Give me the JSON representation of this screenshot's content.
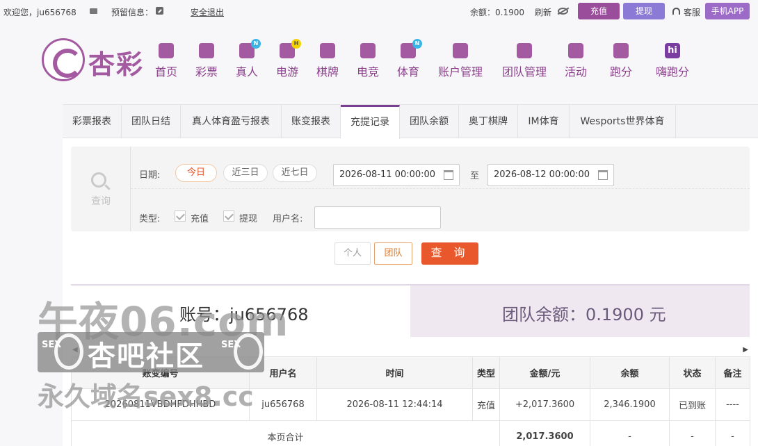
{
  "topbar": {
    "welcome": "欢迎您，ju656768",
    "preset_info": "预留信息：",
    "logout": "安全退出",
    "balance_label": "余额：0.1900",
    "refresh": "刷新",
    "recharge": "充值",
    "withdraw": "提现",
    "service": "客服",
    "app": "手机APP"
  },
  "brand": {
    "name": "杏彩"
  },
  "nav": [
    {
      "label": "首页",
      "icon": "home-icon"
    },
    {
      "label": "彩票",
      "icon": "lottery-icon"
    },
    {
      "label": "真人",
      "icon": "live-dealer-icon",
      "badge": "N"
    },
    {
      "label": "电游",
      "icon": "gamepad-icon",
      "badge": "H"
    },
    {
      "label": "棋牌",
      "icon": "cards-icon"
    },
    {
      "label": "电竞",
      "icon": "esports-icon"
    },
    {
      "label": "体育",
      "icon": "trophy-icon",
      "badge": "N"
    },
    {
      "label": "账户管理",
      "icon": "account-icon"
    },
    {
      "label": "团队管理",
      "icon": "team-icon"
    },
    {
      "label": "活动",
      "icon": "gift-icon"
    },
    {
      "label": "跑分",
      "icon": "car-icon"
    },
    {
      "label": "嗨跑分",
      "icon": "hi-icon",
      "icon_text": "hi"
    }
  ],
  "tabs": [
    "彩票报表",
    "团队日结",
    "真人体育盈亏报表",
    "账变报表",
    "充提记录",
    "团队余额",
    "奥丁棋牌",
    "IM体育",
    "Wesports世界体育"
  ],
  "search": {
    "side_label": "查询",
    "date_label": "日期:",
    "ranges": [
      "今日",
      "近三日",
      "近七日"
    ],
    "start_date": "2026-08-11 00:00:00",
    "to": "至",
    "end_date": "2026-08-12 00:00:00",
    "type_label": "类型:",
    "type_recharge": "充值",
    "type_withdraw": "提现",
    "username_label": "用户名:",
    "username_value": ""
  },
  "buttons": {
    "personal": "个人",
    "team": "团队",
    "query": "查 询"
  },
  "summary": {
    "account": "账号：ju656768",
    "team_balance": "团队余额：0.1900 元"
  },
  "table": {
    "headers": [
      "账变编号",
      "用户名",
      "时间",
      "类型",
      "金额/元",
      "余额",
      "状态",
      "备注"
    ],
    "rows": [
      [
        "20260811VBDHFDHHBD",
        "ju656768",
        "2026-08-11 12:44:14",
        "充值",
        "+2,017.3600",
        "2,346.1900",
        "已到账",
        "----"
      ]
    ],
    "footer": {
      "label": "本页合计",
      "amount": "2,017.3600",
      "balance": "-",
      "status": "-",
      "remark": "-"
    }
  },
  "watermark": {
    "line1": "午夜06.com",
    "sex": "SEX",
    "line2": "杏吧社区",
    "line3": "永久域名sex8.cc"
  },
  "colors": {
    "brand": "#a35aa0",
    "accent": "#e8582c",
    "recharge_btn": "#9a4d9a",
    "withdraw_btn": "#8c7bd6"
  }
}
